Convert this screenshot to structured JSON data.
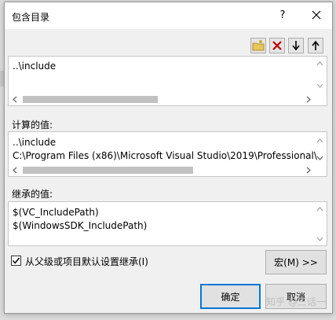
{
  "dialog": {
    "title": "包含目录",
    "help_label": "?"
  },
  "toolbar": {
    "buttons": [
      {
        "icon": "new-folder-icon"
      },
      {
        "icon": "delete-icon",
        "color": "#c00000"
      },
      {
        "icon": "arrow-down-icon"
      },
      {
        "icon": "arrow-up-icon"
      }
    ]
  },
  "editor": {
    "lines": [
      "..\\include"
    ]
  },
  "computed": {
    "label": "计算的值:",
    "lines": [
      "..\\include",
      "C:\\Program Files (x86)\\Microsoft Visual Studio\\2019\\Professional\\"
    ]
  },
  "inherited": {
    "label": "继承的值:",
    "lines": [
      "$(VC_IncludePath)",
      "$(WindowsSDK_IncludePath)"
    ]
  },
  "inherit_checkbox": {
    "label": "从父级或项目默认设置继承(I)",
    "checked": true
  },
  "buttons": {
    "macro": "宏(M) >>",
    "ok": "确定",
    "cancel": "取消"
  },
  "colors": {
    "accent": "#0078d7",
    "delete_icon": "#c00000"
  },
  "watermark": "知乎 @三话一"
}
